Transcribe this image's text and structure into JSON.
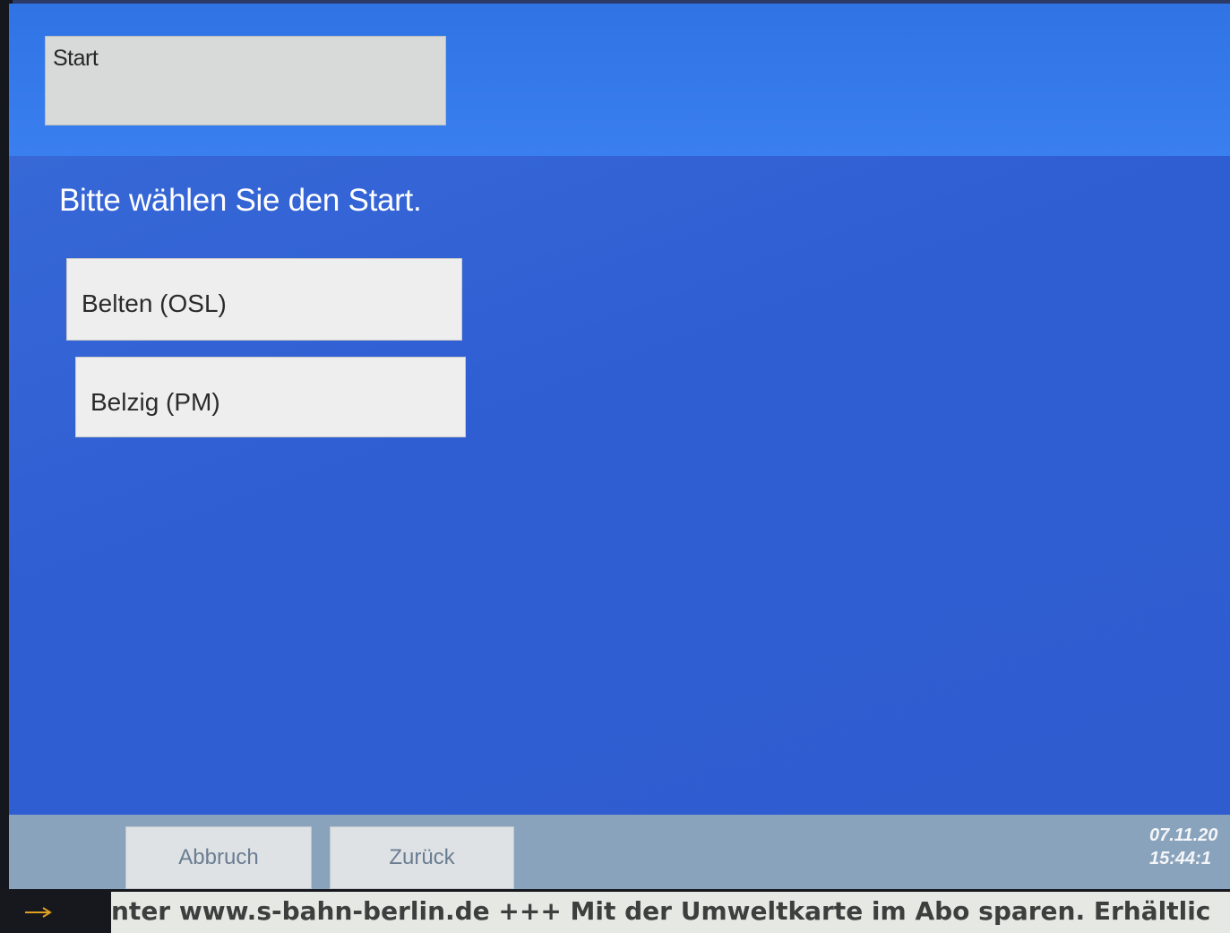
{
  "header": {
    "start_field_label": "Start"
  },
  "main": {
    "prompt": "Bitte wählen Sie den Start.",
    "options": [
      {
        "label": "Belten (OSL)"
      },
      {
        "label": "Belzig (PM)"
      }
    ]
  },
  "footer": {
    "cancel_label": "Abbruch",
    "back_label": "Zurück",
    "date": "07.11.20",
    "time": "15:44:1"
  },
  "ticker": {
    "text": "nter www.s-bahn-berlin.de +++ Mit der Umweltkarte im Abo sparen. Erhältlic"
  },
  "colors": {
    "header_blue": "#2f73e4",
    "main_blue": "#2f5fd6",
    "footer_gray": "#8aa3bd",
    "arrow_accent": "#e0a020"
  },
  "icons": [
    "arrow-right-icon"
  ]
}
